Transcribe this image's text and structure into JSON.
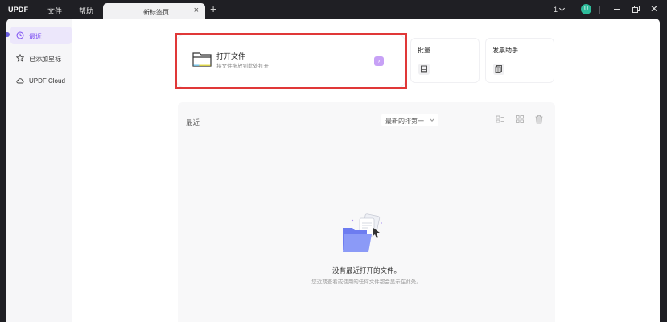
{
  "titlebar": {
    "app_name": "UPDF",
    "menu_file": "文件",
    "menu_help": "帮助",
    "tab_label": "新标签页",
    "page_number": "1",
    "avatar_letter": "U"
  },
  "sidebar": {
    "items": [
      {
        "label": "最近",
        "icon": "clock-icon",
        "active": true
      },
      {
        "label": "已添加星标",
        "icon": "star-icon",
        "active": false
      },
      {
        "label": "UPDF Cloud",
        "icon": "cloud-icon",
        "active": false
      }
    ]
  },
  "cards": {
    "open_title": "打开文件",
    "open_subtitle": "将文件拖放到此处打开",
    "batch_label": "批量",
    "invoice_label": "发票助手"
  },
  "recent": {
    "title": "最近",
    "sort_value": "最新的排第一",
    "empty_title": "没有最近打开的文件。",
    "empty_subtitle": "您近期查看或使用的任何文件都会显示在此处。"
  },
  "colors": {
    "accent": "#7b4cf2",
    "highlight": "#e03838",
    "titlebar_bg": "#1f1f24",
    "avatar": "#2dbb9a"
  }
}
